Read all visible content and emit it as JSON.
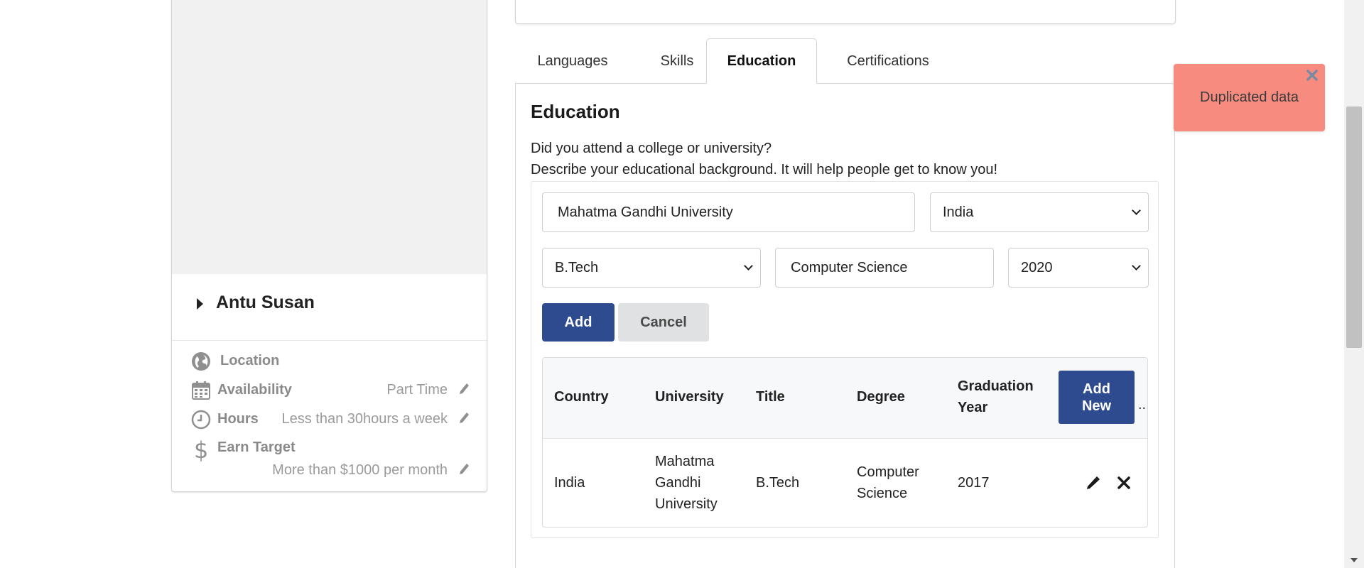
{
  "profile": {
    "name": "Antu Susan",
    "location_label": "Location",
    "availability_label": "Availability",
    "availability_value": "Part Time",
    "hours_label": "Hours",
    "hours_value": "Less than 30hours a week",
    "earn_label": "Earn Target",
    "earn_value": "More than $1000 per month",
    "icons": [
      "globe-icon",
      "calendar-icon",
      "clock-icon",
      "dollar-icon",
      "pencil-icon"
    ]
  },
  "tabs": [
    {
      "label": "Languages",
      "active": false
    },
    {
      "label": "Skills",
      "active": false
    },
    {
      "label": "Education",
      "active": true
    },
    {
      "label": "Certifications",
      "active": false
    }
  ],
  "education": {
    "title": "Education",
    "question": "Did you attend a college or university?",
    "description": "Describe your educational background. It will help people get to know you!",
    "form": {
      "university_value": "Mahatma Gandhi University",
      "country_value": "India",
      "degree_value": "B.Tech",
      "major_value": "Computer Science",
      "year_value": "2020",
      "add_label": "Add",
      "cancel_label": "Cancel"
    },
    "table": {
      "headers": [
        "Country",
        "University",
        "Title",
        "Degree",
        "Graduation",
        "Year"
      ],
      "add_new_label": "Add New",
      "ellipsis": "...",
      "rows": [
        {
          "country": "India",
          "university": [
            "Mahatma",
            "Gandhi",
            "University"
          ],
          "title": "B.Tech",
          "degree": [
            "Computer",
            "Science"
          ],
          "year": "2017"
        }
      ]
    }
  },
  "toast": {
    "message": "Duplicated data",
    "color": "#f88b80"
  },
  "colors": {
    "primary": "#2d4b8e",
    "secondary": "#e0e1e2"
  }
}
